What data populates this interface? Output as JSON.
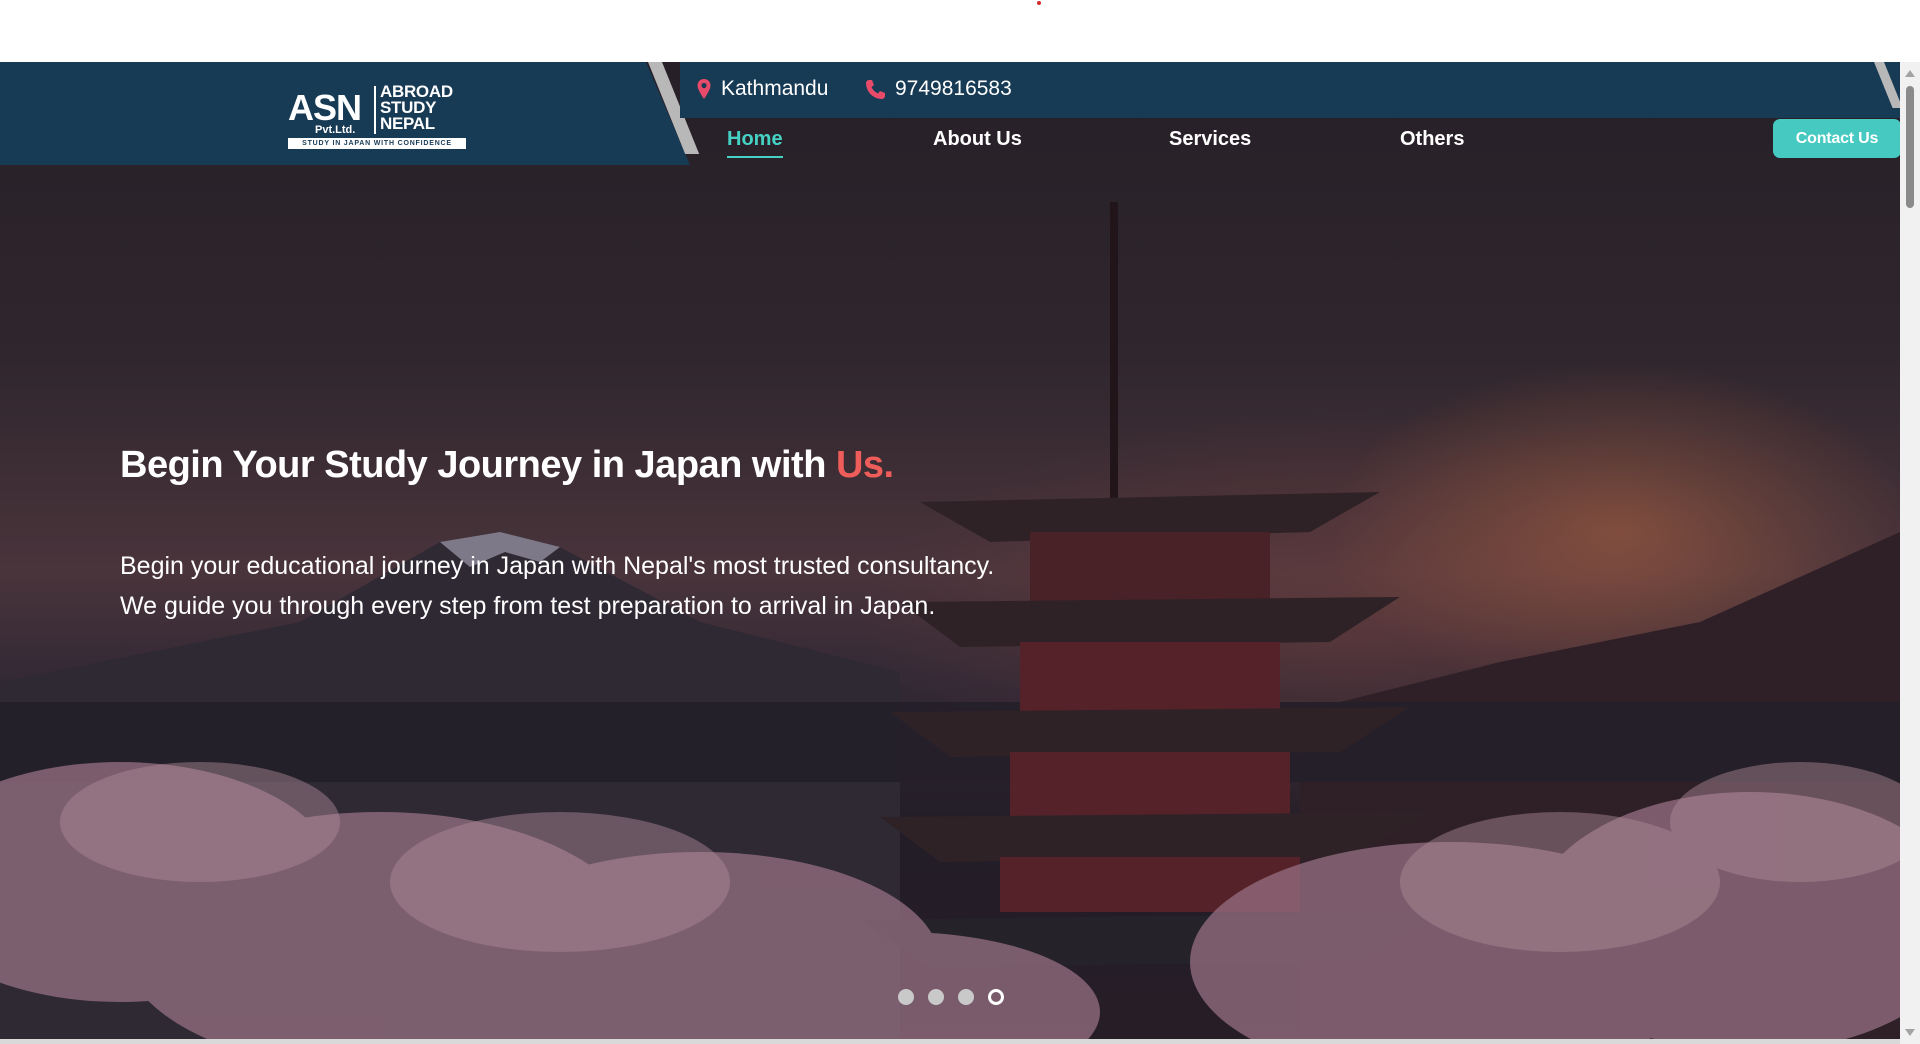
{
  "header": {
    "logo": {
      "main": "ASN",
      "sub": "Pvt.Ltd.",
      "lines": [
        "ABROAD",
        "STUDY",
        "NEPAL"
      ],
      "tagline": "STUDY IN JAPAN WITH CONFIDENCE"
    },
    "location": "Kathmandu",
    "phone": "9749816583",
    "nav": {
      "home": "Home",
      "about": "About Us",
      "services": "Services",
      "others": "Others"
    },
    "contact_button": "Contact Us"
  },
  "hero": {
    "title": "Begin Your Study Journey in Japan with",
    "title_accent": "Us.",
    "description": "Begin your educational journey in Japan with Nepal's most trusted consultancy. We guide you through every step from test preparation to arrival in Japan."
  },
  "carousel": {
    "slide_count": 4,
    "active_index": 3
  },
  "colors": {
    "header_bg": "#173a55",
    "accent_teal": "#45d1c4",
    "accent_red": "#ef5d5a"
  },
  "icons": [
    "map-pin-icon",
    "phone-icon"
  ]
}
